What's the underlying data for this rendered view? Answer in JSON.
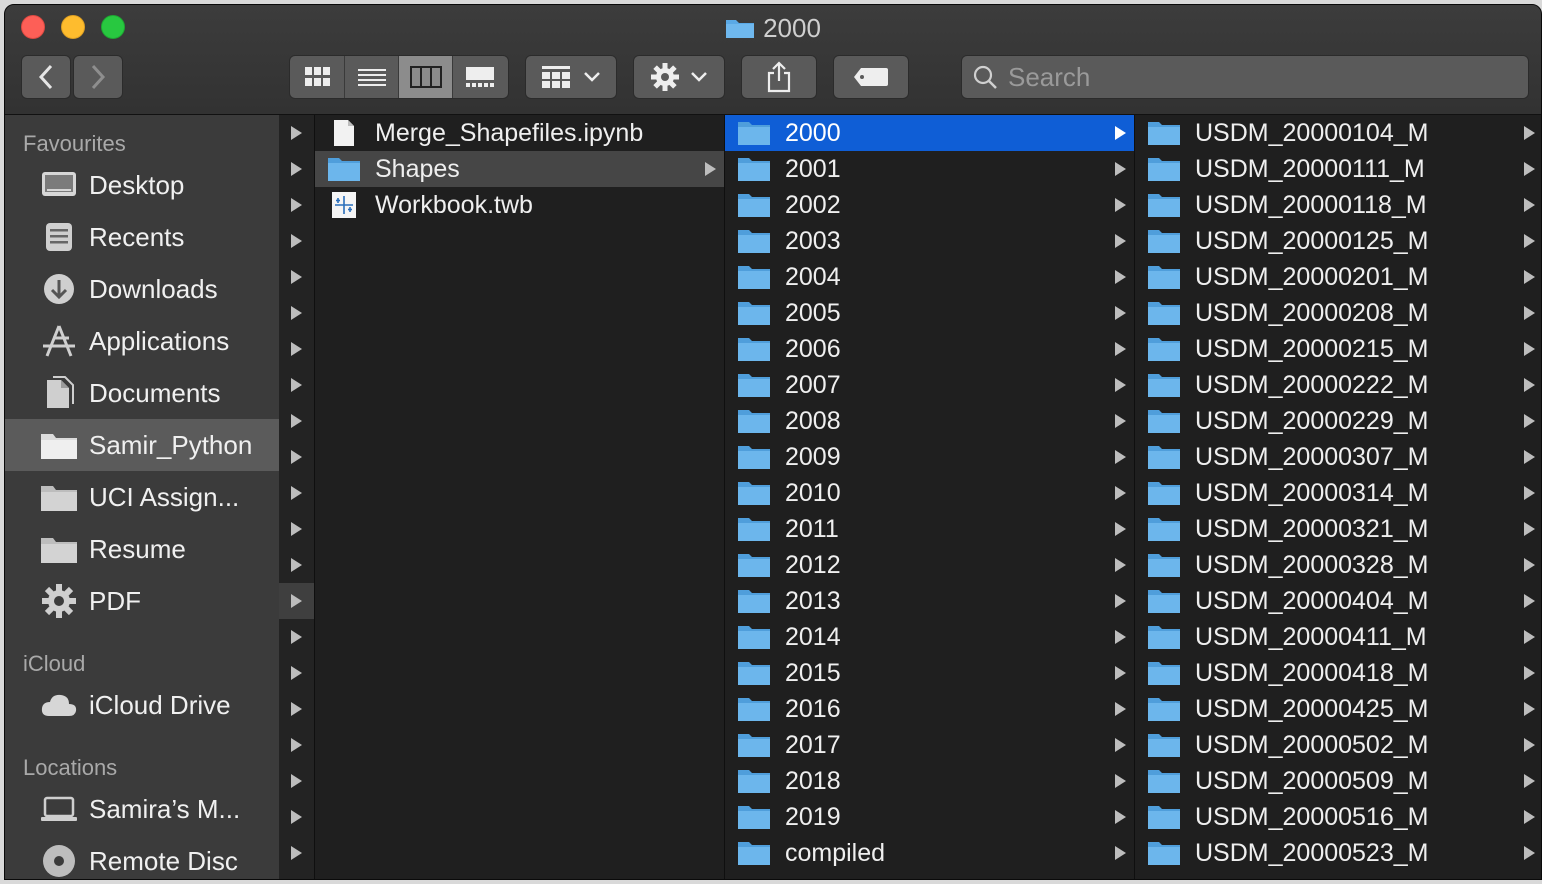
{
  "window": {
    "title": "2000"
  },
  "toolbar": {
    "back_label": "back",
    "forward_label": "forward",
    "search_placeholder": "Search"
  },
  "sidebar": {
    "favourites_header": "Favourites",
    "favourites": [
      {
        "label": "Desktop",
        "icon": "desktop-icon"
      },
      {
        "label": "Recents",
        "icon": "recents-icon"
      },
      {
        "label": "Downloads",
        "icon": "downloads-icon"
      },
      {
        "label": "Applications",
        "icon": "applications-icon"
      },
      {
        "label": "Documents",
        "icon": "documents-icon"
      },
      {
        "label": "Samir_Python",
        "icon": "folder-icon",
        "selected": true
      },
      {
        "label": "UCI Assign...",
        "icon": "folder-icon"
      },
      {
        "label": "Resume",
        "icon": "folder-icon"
      },
      {
        "label": "PDF",
        "icon": "gear-icon"
      }
    ],
    "icloud_header": "iCloud",
    "icloud": [
      {
        "label": "iCloud Drive",
        "icon": "cloud-icon"
      }
    ],
    "locations_header": "Locations",
    "locations": [
      {
        "label": "Samira’s M...",
        "icon": "laptop-icon"
      },
      {
        "label": "Remote Disc",
        "icon": "disc-icon"
      }
    ]
  },
  "column2": [
    {
      "label": "Merge_Shapefiles.ipynb",
      "type": "document"
    },
    {
      "label": "Shapes",
      "type": "folder",
      "selected": true
    },
    {
      "label": "Workbook.twb",
      "type": "tableau"
    }
  ],
  "column3": [
    "2000",
    "2001",
    "2002",
    "2003",
    "2004",
    "2005",
    "2006",
    "2007",
    "2008",
    "2009",
    "2010",
    "2011",
    "2012",
    "2013",
    "2014",
    "2015",
    "2016",
    "2017",
    "2018",
    "2019",
    "compiled"
  ],
  "column4": [
    "USDM_20000104_M",
    "USDM_20000111_M",
    "USDM_20000118_M",
    "USDM_20000125_M",
    "USDM_20000201_M",
    "USDM_20000208_M",
    "USDM_20000215_M",
    "USDM_20000222_M",
    "USDM_20000229_M",
    "USDM_20000307_M",
    "USDM_20000314_M",
    "USDM_20000321_M",
    "USDM_20000328_M",
    "USDM_20000404_M",
    "USDM_20000411_M",
    "USDM_20000418_M",
    "USDM_20000425_M",
    "USDM_20000502_M",
    "USDM_20000509_M",
    "USDM_20000516_M",
    "USDM_20000523_M"
  ],
  "colors": {
    "selection": "#0f5ed6",
    "folder": "#5aa9e6"
  }
}
